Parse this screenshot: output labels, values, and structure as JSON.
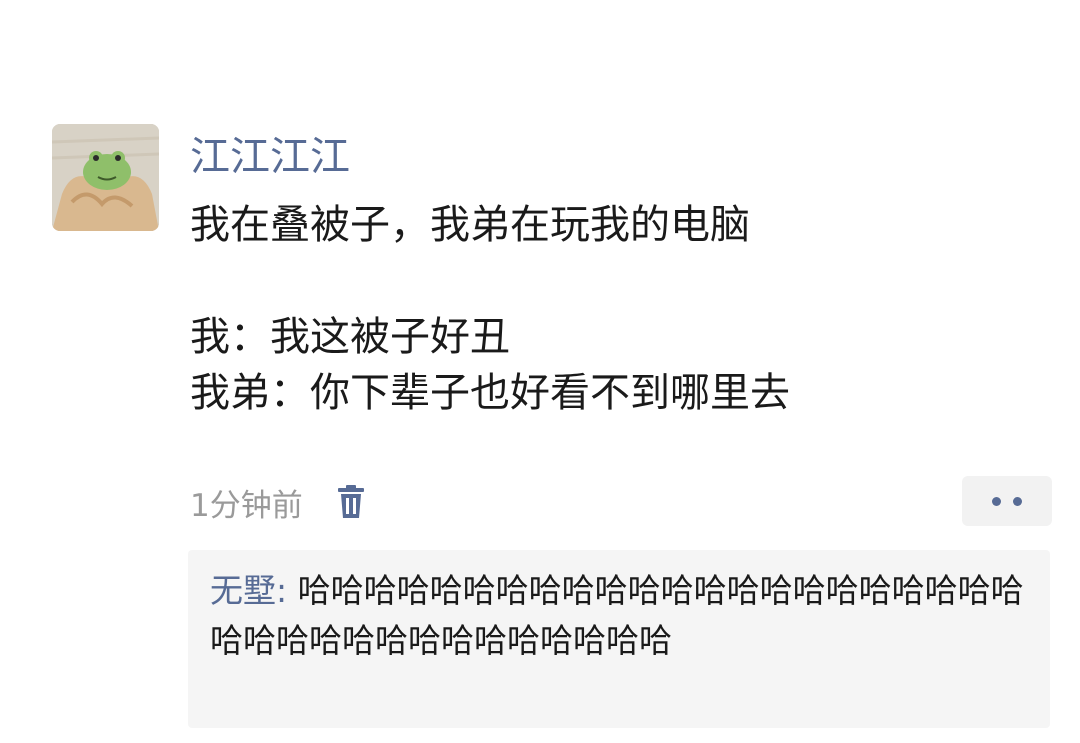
{
  "post": {
    "author": "江江江江",
    "lines": [
      "我在叠被子，我弟在玩我的电脑",
      "",
      "我：我这被子好丑",
      "我弟：你下辈子也好看不到哪里去"
    ],
    "timestamp": "1分钟前",
    "avatar_icon": "frog-plush-avatar",
    "delete_icon": "trash-icon",
    "more_icon": "more-dots-icon"
  },
  "comment": {
    "author": "无墅",
    "separator": ": ",
    "text": "哈哈哈哈哈哈哈哈哈哈哈哈哈哈哈哈哈哈哈哈哈哈哈哈哈哈哈哈哈哈哈哈哈哈哈哈"
  },
  "colors": {
    "link": "#576b95",
    "text": "#1a1a1a",
    "muted": "#9a9a9a",
    "comment_bg": "#f5f5f5"
  }
}
